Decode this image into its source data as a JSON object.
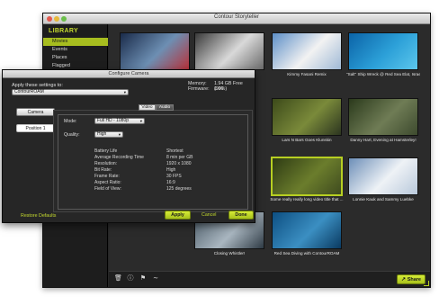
{
  "main_window": {
    "title": "Contour Storyteller"
  },
  "sidebar": {
    "heading": "LIBRARY",
    "items": [
      {
        "label": "Movies",
        "active": true
      },
      {
        "label": "Events",
        "active": false
      },
      {
        "label": "Places",
        "active": false
      },
      {
        "label": "Flagged",
        "active": false
      }
    ]
  },
  "videos": [
    {
      "caption": "",
      "colors": [
        "#1a2b4a",
        "#6d8fb3",
        "#b8323a"
      ]
    },
    {
      "caption": "",
      "colors": [
        "#3a3a3a",
        "#d9d9d9",
        "#6a6a6a"
      ]
    },
    {
      "caption": "Kimmy Fasani Remix",
      "colors": [
        "#5d8fc7",
        "#f2f2f2",
        "#9fb9d6"
      ]
    },
    {
      "caption": "\"Salt\" Ship Wreck @ Red Sea Elat, Israel",
      "colors": [
        "#0b63a7",
        "#2ca0d8",
        "#5cc7ec"
      ]
    },
    {
      "caption": "Lars N Bars Goes Klunskin",
      "colors": [
        "#3c4a1a",
        "#7a8a3a",
        "#2c3520"
      ]
    },
    {
      "caption": "Danny Hart, Evening at Hamsterley!",
      "colors": [
        "#2b3a1c",
        "#6f7c55",
        "#3d4a2e"
      ]
    },
    {
      "caption": "Some really really long video title that ...",
      "colors": [
        "#2e3b14",
        "#6b7d2c",
        "#3f4b1f"
      ],
      "selected": true
    },
    {
      "caption": "Lonnie Kauk and Sammy Luebke",
      "colors": [
        "#6d8fb8",
        "#eef2f6",
        "#b9c9db"
      ]
    },
    {
      "caption": "Closing Whistler!",
      "colors": [
        "#4a5a66",
        "#a9b6c0",
        "#2e3a44"
      ]
    },
    {
      "caption": "Red Sea Diving with ContourROAM",
      "colors": [
        "#0d4f82",
        "#3b8fc2",
        "#0a3a61"
      ]
    }
  ],
  "toolbar": {
    "icons": [
      "trash-icon",
      "info-icon",
      "flag-icon",
      "trim-icon"
    ],
    "share_label": "Share"
  },
  "dialog": {
    "title": "Configure Camera",
    "apply_to_label": "Apply these settings to:",
    "apply_to_value": "ContourROAM",
    "memory_label": "Memory:",
    "memory_value": "1.94 GB Free (99%)",
    "firmware_label": "Firmware:",
    "firmware_value": "1.06",
    "camera_button": "Camera",
    "position_button": "Position 1",
    "tabs": [
      {
        "label": "Video",
        "active": false
      },
      {
        "label": "Audio",
        "active": true
      }
    ],
    "mode_label": "Mode:",
    "mode_value": "Full HD - 1080p",
    "quality_label": "Quality:",
    "quality_value": "High",
    "info": [
      {
        "key": "Battery Life",
        "value": "Shortest"
      },
      {
        "key": "Average Recording Time",
        "value": "8 min per GB"
      },
      {
        "key": "Resolution:",
        "value": "1920 x 1080"
      },
      {
        "key": "Bit Rate:",
        "value": "High"
      },
      {
        "key": "Frame Rate:",
        "value": "30 FPS"
      },
      {
        "key": "Aspect Ratio:",
        "value": "16:9"
      },
      {
        "key": "Field of View:",
        "value": "125 degrees"
      }
    ],
    "restore_label": "Restore Defaults",
    "apply_label": "Apply",
    "cancel_label": "Cancel",
    "done_label": "Done"
  },
  "colors": {
    "accent": "#a7bd1f",
    "accent_text": "#c4d92e",
    "window_bg": "#262626"
  }
}
